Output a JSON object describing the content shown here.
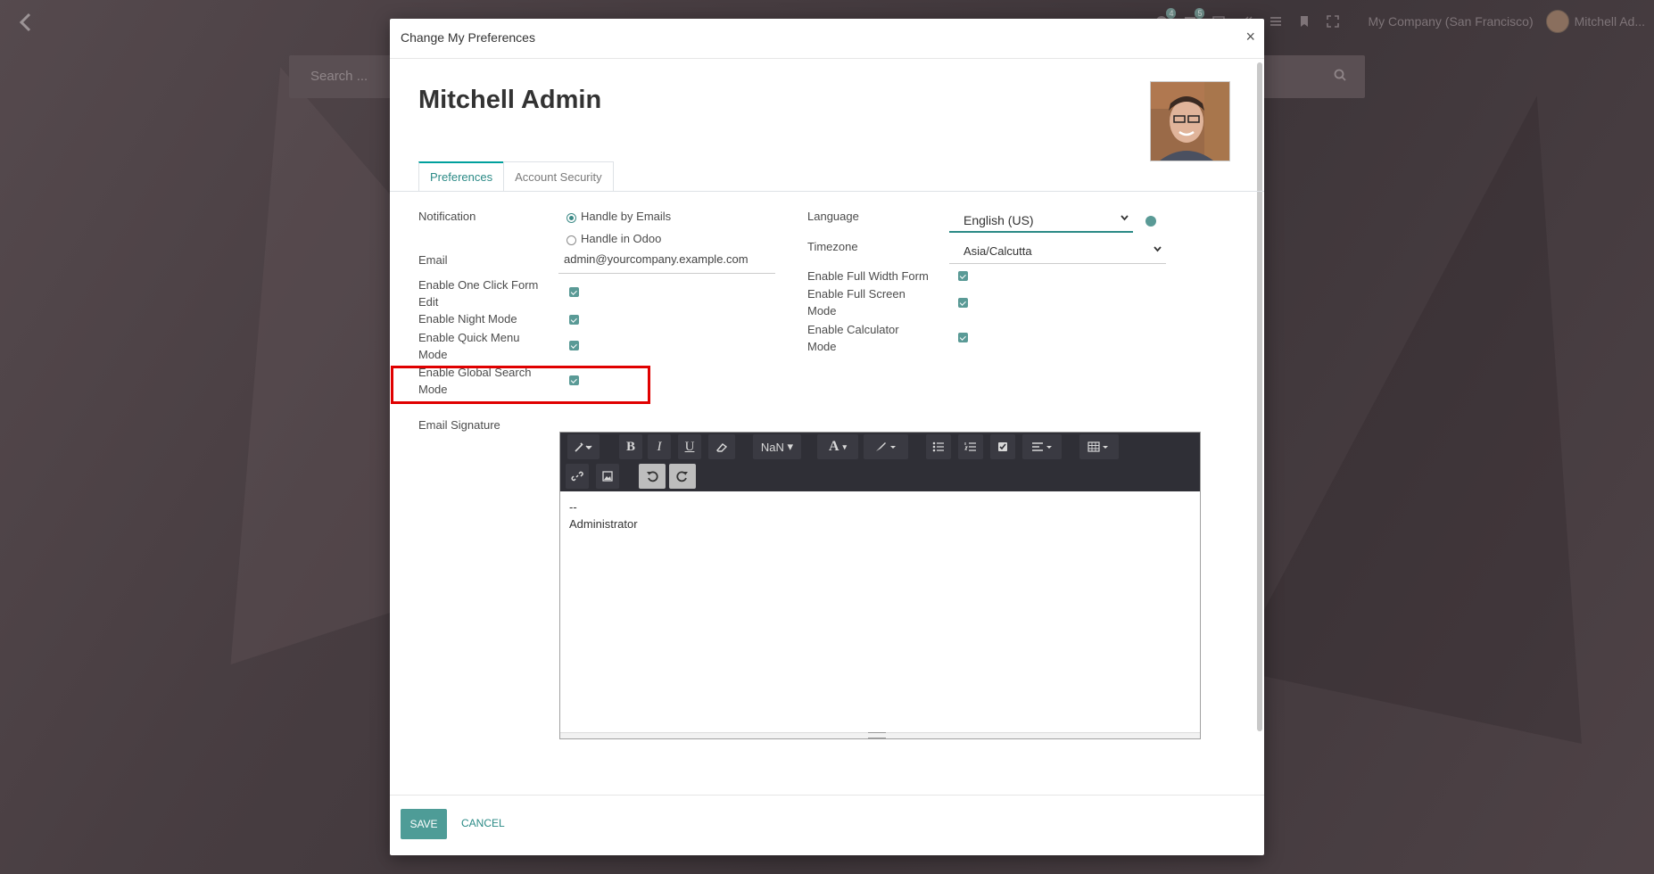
{
  "topbar": {
    "badge1": "4",
    "badge2": "5",
    "company": "My Company (San Francisco)",
    "user": "Mitchell Ad..."
  },
  "search": {
    "placeholder": "Search ..."
  },
  "modal": {
    "title": "Change My Preferences",
    "close": "×",
    "user_name": "Mitchell Admin",
    "tabs": [
      {
        "label": "Preferences",
        "active": true
      },
      {
        "label": "Account Security",
        "active": false
      }
    ],
    "left": {
      "notification_label": "Notification",
      "notification_options": [
        "Handle by Emails",
        "Handle in Odoo"
      ],
      "email_label": "Email",
      "email_value": "admin@yourcompany.example.com",
      "one_click_label": "Enable One Click Form Edit",
      "night_mode_label": "Enable Night Mode",
      "quick_menu_label": "Enable Quick Menu Mode",
      "global_search_label": "Enable Global Search Mode",
      "signature_label": "Email Signature"
    },
    "right": {
      "language_label": "Language",
      "language_value": "English (US)",
      "timezone_label": "Timezone",
      "timezone_value": "Asia/Calcutta",
      "full_width_label": "Enable Full Width Form",
      "full_screen_label": "Enable Full Screen Mode",
      "calculator_label": "Enable Calculator Mode"
    },
    "editor": {
      "font_size": "NaN",
      "content_line1": "--",
      "content_line2": "Administrator"
    },
    "footer": {
      "save": "SAVE",
      "cancel": "CANCEL"
    }
  }
}
